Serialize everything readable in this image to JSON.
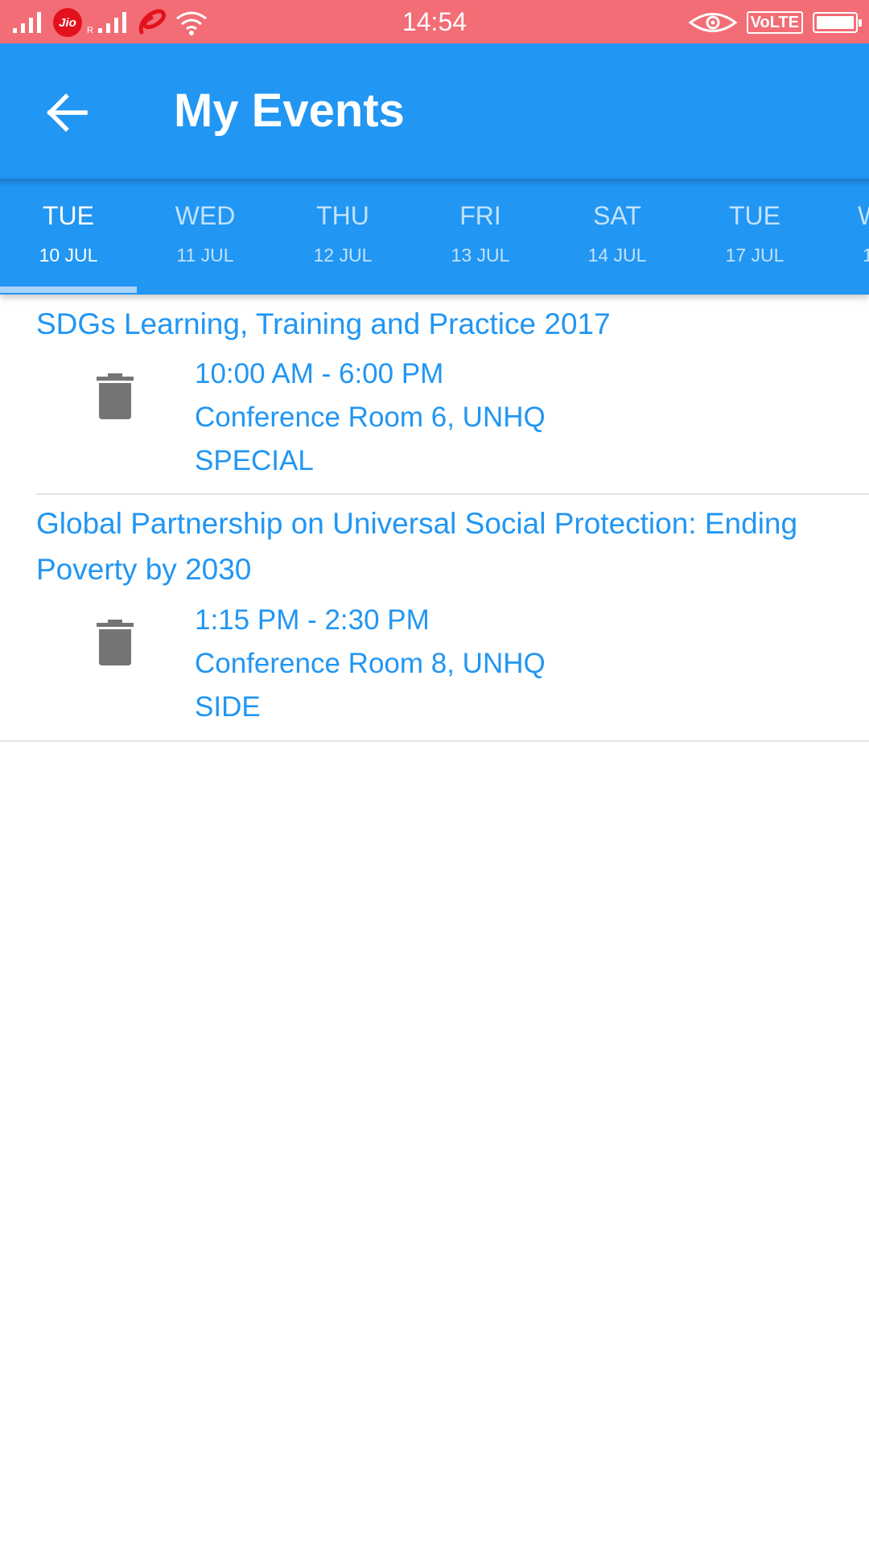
{
  "status_bar": {
    "carrier": "Jio",
    "time": "14:54",
    "network_badge": "VoLTE",
    "icons": [
      "signal-icon",
      "jio-icon",
      "roaming-signal-icon",
      "airtel-icon",
      "wifi-icon",
      "eye-icon",
      "volte-icon",
      "battery-icon"
    ]
  },
  "app_bar": {
    "title": "My Events",
    "back_icon": "arrow-left-icon",
    "color": "#2196f3"
  },
  "tabs": [
    {
      "day": "TUE",
      "date": "10 JUL",
      "selected": true
    },
    {
      "day": "WED",
      "date": "11 JUL",
      "selected": false
    },
    {
      "day": "THU",
      "date": "12 JUL",
      "selected": false
    },
    {
      "day": "FRI",
      "date": "13 JUL",
      "selected": false
    },
    {
      "day": "SAT",
      "date": "14 JUL",
      "selected": false
    },
    {
      "day": "TUE",
      "date": "17 JUL",
      "selected": false
    },
    {
      "day": "W",
      "date": "1",
      "selected": false
    }
  ],
  "events": [
    {
      "title": "SDGs Learning, Training and Practice 2017",
      "time": "10:00 AM - 6:00 PM",
      "location": "Conference Room 6, UNHQ",
      "category": "SPECIAL",
      "action_icon": "trash-icon"
    },
    {
      "title": "Global Partnership on Universal Social Protection: Ending Poverty by 2030",
      "time": "1:15 PM - 2:30 PM",
      "location": "Conference Room 8, UNHQ",
      "category": "SIDE",
      "action_icon": "trash-icon"
    }
  ],
  "colors": {
    "status_bar": "#f26d75",
    "primary": "#2196f3",
    "text_link": "#2196f3",
    "icon_gray": "#757575"
  }
}
